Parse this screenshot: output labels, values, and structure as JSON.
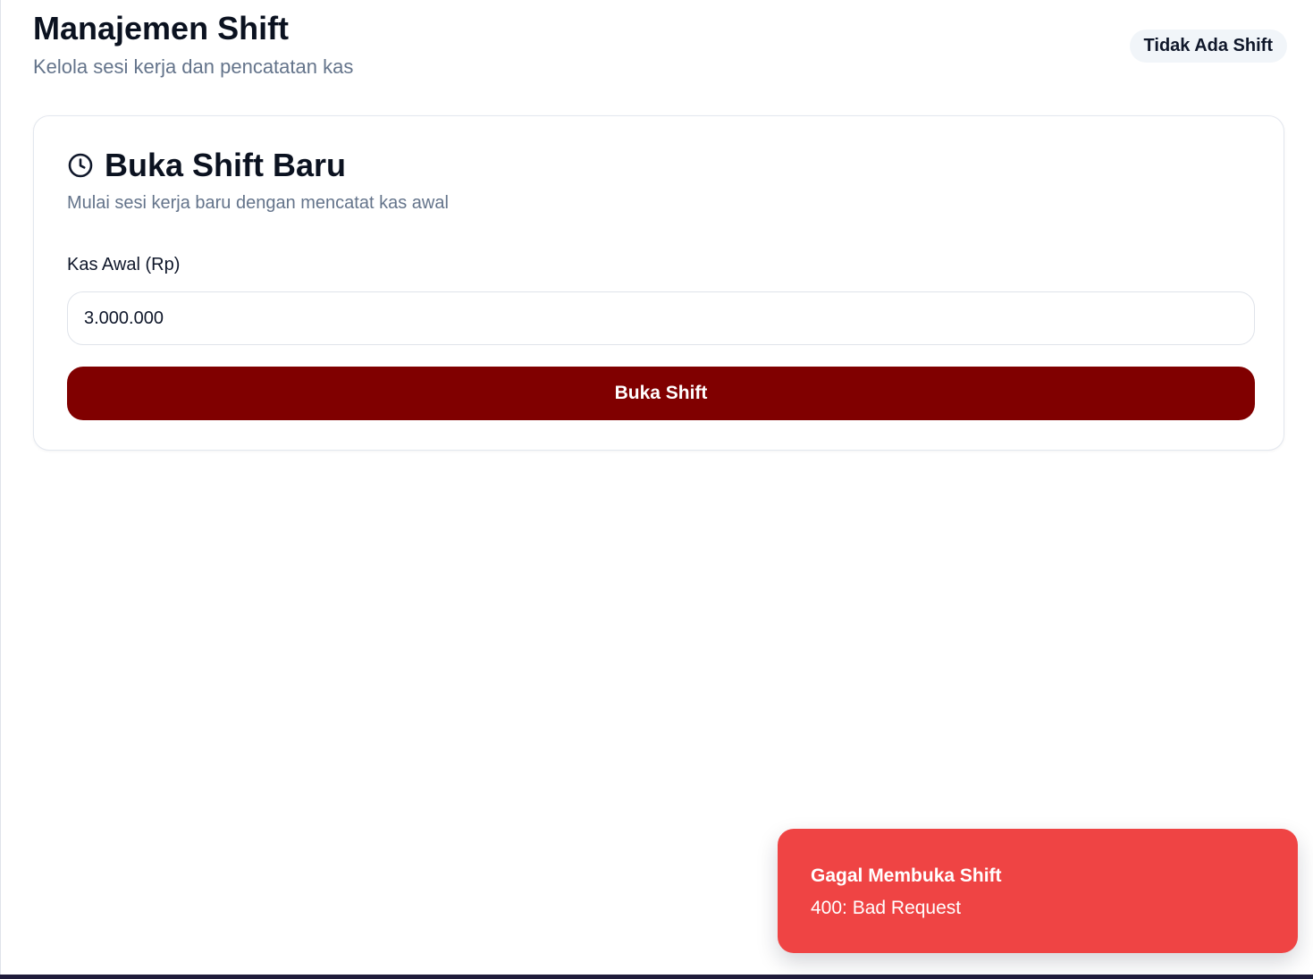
{
  "header": {
    "title": "Manajemen Shift",
    "subtitle": "Kelola sesi kerja dan pencatatan kas",
    "status_badge": "Tidak Ada Shift"
  },
  "open_shift_card": {
    "icon": "clock-icon",
    "title": "Buka Shift Baru",
    "subtitle": "Mulai sesi kerja baru dengan mencatat kas awal",
    "cash_label": "Kas Awal (Rp)",
    "cash_value": "3.000.000",
    "button_label": "Buka Shift"
  },
  "toast": {
    "title": "Gagal Membuka Shift",
    "message": "400: Bad Request"
  },
  "colors": {
    "primary": "#800000",
    "error": "#ef4444",
    "muted_text": "#64748b",
    "badge_background": "#f1f5f9"
  }
}
